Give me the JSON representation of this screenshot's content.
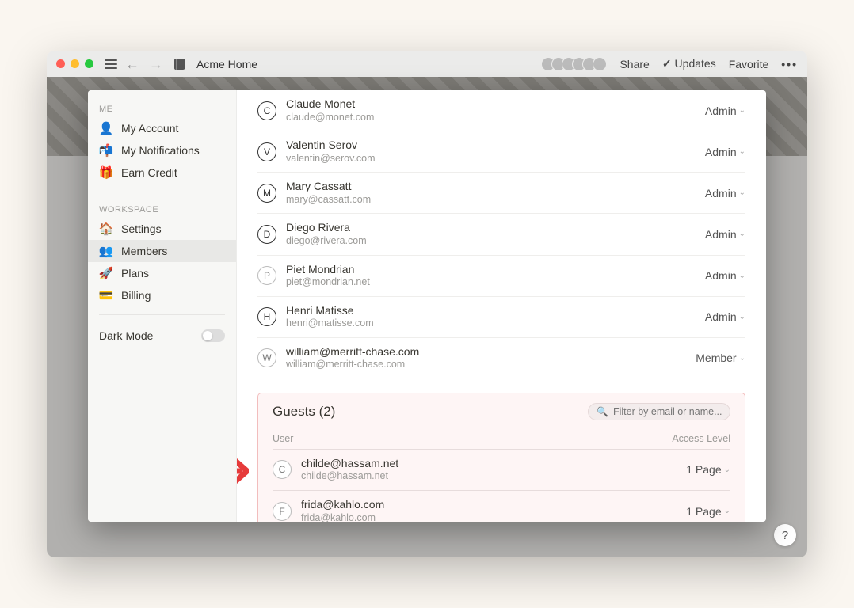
{
  "chrome": {
    "title": "Acme Home",
    "share": "Share",
    "updates": "Updates",
    "favorite": "Favorite"
  },
  "sidebar": {
    "me_heading": "ME",
    "workspace_heading": "WORKSPACE",
    "items_me": [
      {
        "icon": "👤",
        "label": "My Account"
      },
      {
        "icon": "📬",
        "label": "My Notifications"
      },
      {
        "icon": "🎁",
        "label": "Earn Credit"
      }
    ],
    "items_ws": [
      {
        "icon": "🏠",
        "label": "Settings"
      },
      {
        "icon": "👥",
        "label": "Members"
      },
      {
        "icon": "🚀",
        "label": "Plans"
      },
      {
        "icon": "💳",
        "label": "Billing"
      }
    ],
    "dark_mode": "Dark Mode"
  },
  "members": [
    {
      "name": "Claude Monet",
      "email": "claude@monet.com",
      "role": "Admin",
      "initial": "C",
      "style": "face"
    },
    {
      "name": "Valentin Serov",
      "email": "valentin@serov.com",
      "role": "Admin",
      "initial": "V",
      "style": "face"
    },
    {
      "name": "Mary Cassatt",
      "email": "mary@cassatt.com",
      "role": "Admin",
      "initial": "M",
      "style": "face"
    },
    {
      "name": "Diego Rivera",
      "email": "diego@rivera.com",
      "role": "Admin",
      "initial": "D",
      "style": "face"
    },
    {
      "name": "Piet Mondrian",
      "email": "piet@mondrian.net",
      "role": "Admin",
      "initial": "P",
      "style": "light"
    },
    {
      "name": "Henri Matisse",
      "email": "henri@matisse.com",
      "role": "Admin",
      "initial": "H",
      "style": "face"
    },
    {
      "name": "william@merritt-chase.com",
      "email": "william@merritt-chase.com",
      "role": "Member",
      "initial": "W",
      "style": "light"
    }
  ],
  "guests": {
    "title": "Guests (2)",
    "filter_placeholder": "Filter by email or name...",
    "col_user": "User",
    "col_access": "Access Level",
    "rows": [
      {
        "name": "childe@hassam.net",
        "email": "childe@hassam.net",
        "role": "1 Page",
        "initial": "C"
      },
      {
        "name": "frida@kahlo.com",
        "email": "frida@kahlo.com",
        "role": "1 Page",
        "initial": "F"
      }
    ]
  },
  "help": "?"
}
